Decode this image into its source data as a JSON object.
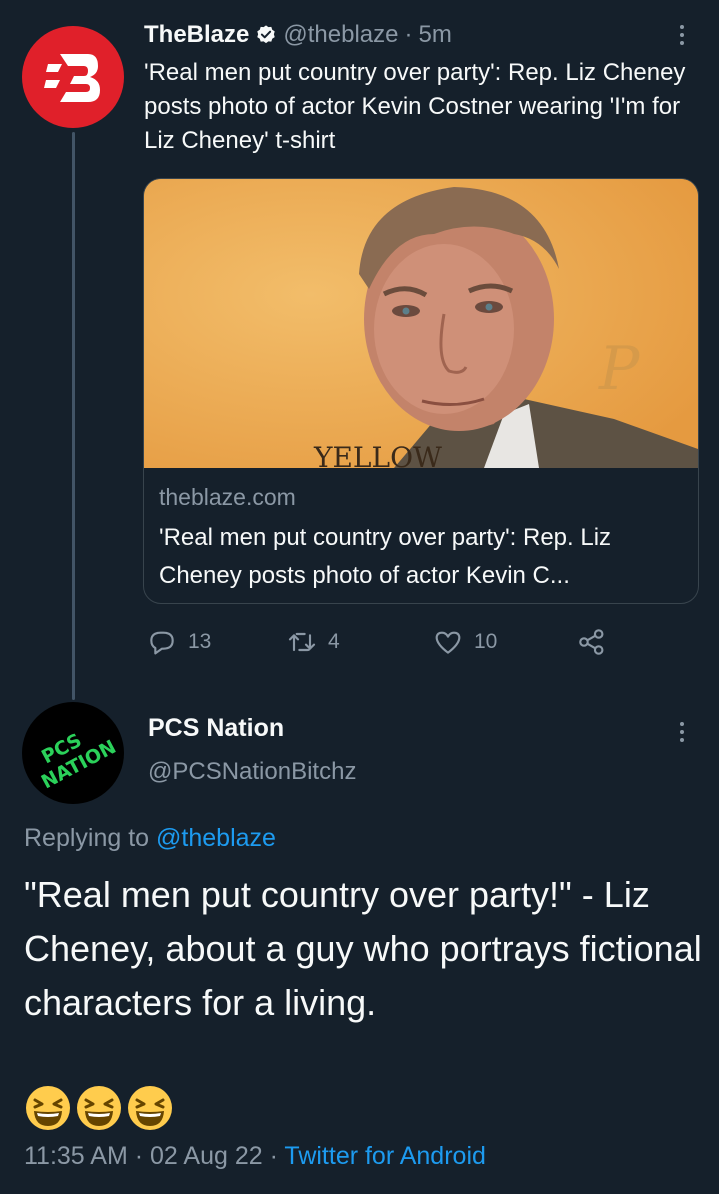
{
  "tweet1": {
    "name": "TheBlaze",
    "handle": "@theblaze",
    "sep": "·",
    "time": "5m",
    "text": "'Real men put country over party': Rep. Liz Cheney posts photo of actor Kevin Costner wearing 'I'm for Liz Cheney' t-shirt",
    "card": {
      "image_sign_text": "YELLOW",
      "domain": "theblaze.com",
      "title": "'Real men put country over party': Rep. Liz Cheney posts photo of actor Kevin C..."
    },
    "actions": {
      "replies": "13",
      "retweets": "4",
      "likes": "10"
    }
  },
  "tweet2": {
    "name": "PCS Nation",
    "handle": "@PCSNationBitchz",
    "avatar_text": [
      "PCS",
      "NATION"
    ],
    "replying_prefix": "Replying to",
    "replying_handle": "@theblaze",
    "text": "\"Real men put country over party!\" - Liz Cheney, about a guy who portrays fictional characters for a living.",
    "emojis": [
      "😆",
      "😆",
      "😆"
    ],
    "time": "11:35 AM",
    "sep1": "·",
    "date": "02 Aug 22",
    "sep2": "·",
    "source": "Twitter for Android"
  },
  "colors": {
    "background": "#15202b",
    "accent": "#1d9bf0",
    "muted": "#8b98a5",
    "blaze_red": "#e0202a"
  },
  "icons": [
    "blaze-logo-icon",
    "verified-badge-icon",
    "more-icon",
    "reply-icon",
    "retweet-icon",
    "like-icon",
    "share-icon",
    "laughing-emoji-icon"
  ]
}
